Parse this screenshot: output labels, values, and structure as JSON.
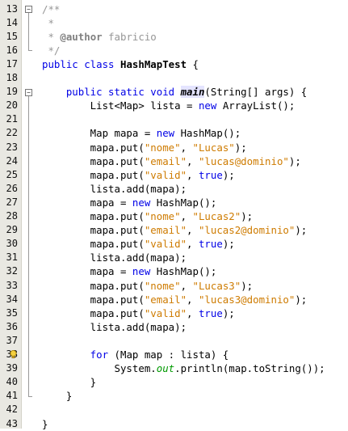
{
  "editor": {
    "line_numbers": [
      "13",
      "14",
      "15",
      "16",
      "17",
      "18",
      "19",
      "20",
      "21",
      "22",
      "23",
      "24",
      "25",
      "26",
      "27",
      "28",
      "29",
      "30",
      "31",
      "32",
      "33",
      "34",
      "35",
      "36",
      "37",
      "38",
      "39",
      "40",
      "41",
      "42",
      "43"
    ],
    "lines": [
      [
        {
          "t": "/**",
          "c": "cm"
        }
      ],
      [
        {
          "t": " *",
          "c": "cm"
        }
      ],
      [
        {
          "t": " * ",
          "c": "cm"
        },
        {
          "t": "@author",
          "c": "cm-tag"
        },
        {
          "t": " fabricio",
          "c": "cm"
        }
      ],
      [
        {
          "t": " */",
          "c": "cm"
        }
      ],
      [
        {
          "t": "public class ",
          "c": "kw"
        },
        {
          "t": "HashMapTest",
          "c": "cls-name"
        },
        {
          "t": " {",
          "c": ""
        }
      ],
      [],
      [
        {
          "t": "    public static void ",
          "c": "kw"
        },
        {
          "t": "main",
          "c": "mth"
        },
        {
          "t": "(String[] args) {",
          "c": ""
        }
      ],
      [
        {
          "t": "        List<Map> lista = ",
          "c": ""
        },
        {
          "t": "new",
          "c": "kw"
        },
        {
          "t": " ArrayList();",
          "c": ""
        }
      ],
      [],
      [
        {
          "t": "        Map mapa = ",
          "c": ""
        },
        {
          "t": "new",
          "c": "kw"
        },
        {
          "t": " HashMap();",
          "c": ""
        }
      ],
      [
        {
          "t": "        mapa.put(",
          "c": ""
        },
        {
          "t": "\"nome\"",
          "c": "str"
        },
        {
          "t": ", ",
          "c": ""
        },
        {
          "t": "\"Lucas\"",
          "c": "str"
        },
        {
          "t": ");",
          "c": ""
        }
      ],
      [
        {
          "t": "        mapa.put(",
          "c": ""
        },
        {
          "t": "\"email\"",
          "c": "str"
        },
        {
          "t": ", ",
          "c": ""
        },
        {
          "t": "\"lucas@dominio\"",
          "c": "str"
        },
        {
          "t": ");",
          "c": ""
        }
      ],
      [
        {
          "t": "        mapa.put(",
          "c": ""
        },
        {
          "t": "\"valid\"",
          "c": "str"
        },
        {
          "t": ", ",
          "c": ""
        },
        {
          "t": "true",
          "c": "kw"
        },
        {
          "t": ");",
          "c": ""
        }
      ],
      [
        {
          "t": "        lista.add(mapa);",
          "c": ""
        }
      ],
      [
        {
          "t": "        mapa = ",
          "c": ""
        },
        {
          "t": "new",
          "c": "kw"
        },
        {
          "t": " HashMap();",
          "c": ""
        }
      ],
      [
        {
          "t": "        mapa.put(",
          "c": ""
        },
        {
          "t": "\"nome\"",
          "c": "str"
        },
        {
          "t": ", ",
          "c": ""
        },
        {
          "t": "\"Lucas2\"",
          "c": "str"
        },
        {
          "t": ");",
          "c": ""
        }
      ],
      [
        {
          "t": "        mapa.put(",
          "c": ""
        },
        {
          "t": "\"email\"",
          "c": "str"
        },
        {
          "t": ", ",
          "c": ""
        },
        {
          "t": "\"lucas2@dominio\"",
          "c": "str"
        },
        {
          "t": ");",
          "c": ""
        }
      ],
      [
        {
          "t": "        mapa.put(",
          "c": ""
        },
        {
          "t": "\"valid\"",
          "c": "str"
        },
        {
          "t": ", ",
          "c": ""
        },
        {
          "t": "true",
          "c": "kw"
        },
        {
          "t": ");",
          "c": ""
        }
      ],
      [
        {
          "t": "        lista.add(mapa);",
          "c": ""
        }
      ],
      [
        {
          "t": "        mapa = ",
          "c": ""
        },
        {
          "t": "new",
          "c": "kw"
        },
        {
          "t": " HashMap();",
          "c": ""
        }
      ],
      [
        {
          "t": "        mapa.put(",
          "c": ""
        },
        {
          "t": "\"nome\"",
          "c": "str"
        },
        {
          "t": ", ",
          "c": ""
        },
        {
          "t": "\"Lucas3\"",
          "c": "str"
        },
        {
          "t": ");",
          "c": ""
        }
      ],
      [
        {
          "t": "        mapa.put(",
          "c": ""
        },
        {
          "t": "\"email\"",
          "c": "str"
        },
        {
          "t": ", ",
          "c": ""
        },
        {
          "t": "\"lucas3@dominio\"",
          "c": "str"
        },
        {
          "t": ");",
          "c": ""
        }
      ],
      [
        {
          "t": "        mapa.put(",
          "c": ""
        },
        {
          "t": "\"valid\"",
          "c": "str"
        },
        {
          "t": ", ",
          "c": ""
        },
        {
          "t": "true",
          "c": "kw"
        },
        {
          "t": ");",
          "c": ""
        }
      ],
      [
        {
          "t": "        lista.add(mapa);",
          "c": ""
        }
      ],
      [],
      [
        {
          "t": "        for",
          "c": "kw"
        },
        {
          "t": " (Map map : lista) {",
          "c": ""
        }
      ],
      [
        {
          "t": "            System.",
          "c": ""
        },
        {
          "t": "out",
          "c": "fld"
        },
        {
          "t": ".println(map.toString());",
          "c": ""
        }
      ],
      [
        {
          "t": "        }",
          "c": ""
        }
      ],
      [
        {
          "t": "    }",
          "c": ""
        }
      ],
      [],
      [
        {
          "t": "}",
          "c": ""
        }
      ]
    ],
    "fold_markers": [
      {
        "line": "13",
        "symbol": "−"
      },
      {
        "line": "19",
        "symbol": "−"
      }
    ],
    "hint_icon": {
      "line": "38",
      "name": "lightbulb-icon"
    }
  }
}
